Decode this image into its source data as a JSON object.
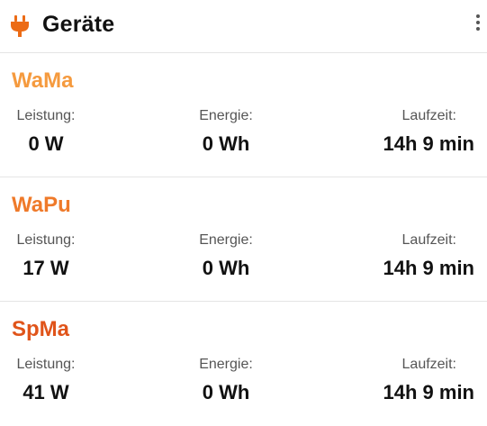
{
  "header": {
    "title": "Geräte",
    "icon": "plug-icon",
    "menu_icon": "more-vert-icon"
  },
  "colors": {
    "accent": "#ec6b15"
  },
  "devices": [
    {
      "name": "WaMa",
      "name_color": "#f59a3e",
      "power_label": "Leistung:",
      "power_value": "0 W",
      "energy_label": "Energie:",
      "energy_value": "0 Wh",
      "runtime_label": "Laufzeit:",
      "runtime_value": "14h 9 min"
    },
    {
      "name": "WaPu",
      "name_color": "#ef7a2a",
      "power_label": "Leistung:",
      "power_value": "17 W",
      "energy_label": "Energie:",
      "energy_value": "0 Wh",
      "runtime_label": "Laufzeit:",
      "runtime_value": "14h 9 min"
    },
    {
      "name": "SpMa",
      "name_color": "#e0541a",
      "power_label": "Leistung:",
      "power_value": "41 W",
      "energy_label": "Energie:",
      "energy_value": "0 Wh",
      "runtime_label": "Laufzeit:",
      "runtime_value": "14h 9 min"
    }
  ]
}
